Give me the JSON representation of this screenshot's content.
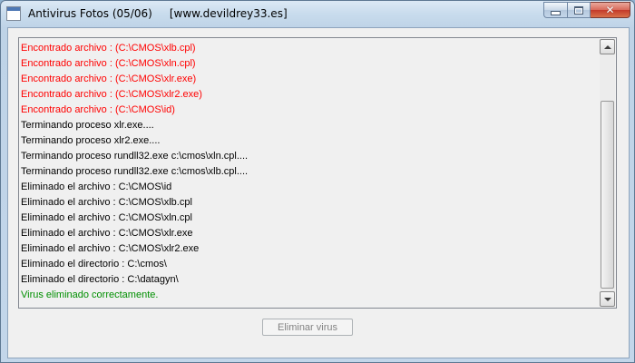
{
  "window": {
    "title": "Antivirus Fotos (05/06)     [www.devildrey33.es]"
  },
  "caption_buttons": {
    "minimize_icon": "minimize-icon",
    "maximize_icon": "maximize-icon",
    "close_icon": "close-icon",
    "close_glyph": "✕",
    "close_color": "#c84031"
  },
  "log": {
    "lines": [
      {
        "text": "Encontrado archivo : (C:\\CMOS\\xlb.cpl)",
        "color": "red"
      },
      {
        "text": "Encontrado archivo : (C:\\CMOS\\xln.cpl)",
        "color": "red"
      },
      {
        "text": "Encontrado archivo : (C:\\CMOS\\xlr.exe)",
        "color": "red"
      },
      {
        "text": "Encontrado archivo : (C:\\CMOS\\xlr2.exe)",
        "color": "red"
      },
      {
        "text": "Encontrado archivo : (C:\\CMOS\\id)",
        "color": "red"
      },
      {
        "text": "Terminando proceso xlr.exe....",
        "color": "black"
      },
      {
        "text": "Terminando proceso xlr2.exe....",
        "color": "black"
      },
      {
        "text": "Terminando proceso rundll32.exe c:\\cmos\\xln.cpl....",
        "color": "black"
      },
      {
        "text": "Terminando proceso rundll32.exe c:\\cmos\\xlb.cpl....",
        "color": "black"
      },
      {
        "text": "Eliminado el archivo : C:\\CMOS\\id",
        "color": "black"
      },
      {
        "text": "Eliminado el archivo : C:\\CMOS\\xlb.cpl",
        "color": "black"
      },
      {
        "text": "Eliminado el archivo : C:\\CMOS\\xln.cpl",
        "color": "black"
      },
      {
        "text": "Eliminado el archivo : C:\\CMOS\\xlr.exe",
        "color": "black"
      },
      {
        "text": "Eliminado el archivo : C:\\CMOS\\xlr2.exe",
        "color": "black"
      },
      {
        "text": "Eliminado el directorio : C:\\cmos\\",
        "color": "black"
      },
      {
        "text": "Eliminado el directorio : C:\\datagyn\\",
        "color": "black"
      },
      {
        "text": "Virus eliminado correctamente.",
        "color": "green"
      }
    ]
  },
  "colors": {
    "found": "#ff0000",
    "normal": "#000000",
    "success": "#008f00",
    "disabled_text": "#838383"
  },
  "action_button": {
    "label": "Eliminar virus",
    "enabled": false
  }
}
